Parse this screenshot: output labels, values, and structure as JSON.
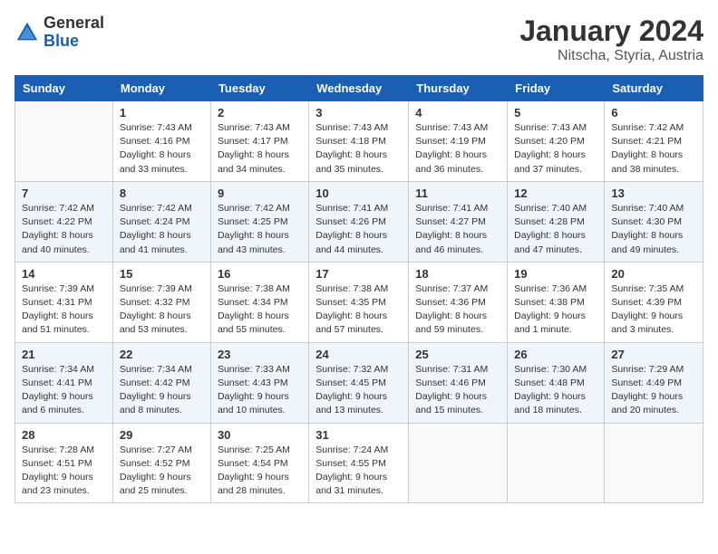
{
  "header": {
    "logo": {
      "general": "General",
      "blue": "Blue"
    },
    "title": "January 2024",
    "subtitle": "Nitscha, Styria, Austria"
  },
  "columns": [
    "Sunday",
    "Monday",
    "Tuesday",
    "Wednesday",
    "Thursday",
    "Friday",
    "Saturday"
  ],
  "weeks": [
    [
      {
        "day": "",
        "sunrise": "",
        "sunset": "",
        "daylight": ""
      },
      {
        "day": "1",
        "sunrise": "Sunrise: 7:43 AM",
        "sunset": "Sunset: 4:16 PM",
        "daylight": "Daylight: 8 hours and 33 minutes."
      },
      {
        "day": "2",
        "sunrise": "Sunrise: 7:43 AM",
        "sunset": "Sunset: 4:17 PM",
        "daylight": "Daylight: 8 hours and 34 minutes."
      },
      {
        "day": "3",
        "sunrise": "Sunrise: 7:43 AM",
        "sunset": "Sunset: 4:18 PM",
        "daylight": "Daylight: 8 hours and 35 minutes."
      },
      {
        "day": "4",
        "sunrise": "Sunrise: 7:43 AM",
        "sunset": "Sunset: 4:19 PM",
        "daylight": "Daylight: 8 hours and 36 minutes."
      },
      {
        "day": "5",
        "sunrise": "Sunrise: 7:43 AM",
        "sunset": "Sunset: 4:20 PM",
        "daylight": "Daylight: 8 hours and 37 minutes."
      },
      {
        "day": "6",
        "sunrise": "Sunrise: 7:42 AM",
        "sunset": "Sunset: 4:21 PM",
        "daylight": "Daylight: 8 hours and 38 minutes."
      }
    ],
    [
      {
        "day": "7",
        "sunrise": "Sunrise: 7:42 AM",
        "sunset": "Sunset: 4:22 PM",
        "daylight": "Daylight: 8 hours and 40 minutes."
      },
      {
        "day": "8",
        "sunrise": "Sunrise: 7:42 AM",
        "sunset": "Sunset: 4:24 PM",
        "daylight": "Daylight: 8 hours and 41 minutes."
      },
      {
        "day": "9",
        "sunrise": "Sunrise: 7:42 AM",
        "sunset": "Sunset: 4:25 PM",
        "daylight": "Daylight: 8 hours and 43 minutes."
      },
      {
        "day": "10",
        "sunrise": "Sunrise: 7:41 AM",
        "sunset": "Sunset: 4:26 PM",
        "daylight": "Daylight: 8 hours and 44 minutes."
      },
      {
        "day": "11",
        "sunrise": "Sunrise: 7:41 AM",
        "sunset": "Sunset: 4:27 PM",
        "daylight": "Daylight: 8 hours and 46 minutes."
      },
      {
        "day": "12",
        "sunrise": "Sunrise: 7:40 AM",
        "sunset": "Sunset: 4:28 PM",
        "daylight": "Daylight: 8 hours and 47 minutes."
      },
      {
        "day": "13",
        "sunrise": "Sunrise: 7:40 AM",
        "sunset": "Sunset: 4:30 PM",
        "daylight": "Daylight: 8 hours and 49 minutes."
      }
    ],
    [
      {
        "day": "14",
        "sunrise": "Sunrise: 7:39 AM",
        "sunset": "Sunset: 4:31 PM",
        "daylight": "Daylight: 8 hours and 51 minutes."
      },
      {
        "day": "15",
        "sunrise": "Sunrise: 7:39 AM",
        "sunset": "Sunset: 4:32 PM",
        "daylight": "Daylight: 8 hours and 53 minutes."
      },
      {
        "day": "16",
        "sunrise": "Sunrise: 7:38 AM",
        "sunset": "Sunset: 4:34 PM",
        "daylight": "Daylight: 8 hours and 55 minutes."
      },
      {
        "day": "17",
        "sunrise": "Sunrise: 7:38 AM",
        "sunset": "Sunset: 4:35 PM",
        "daylight": "Daylight: 8 hours and 57 minutes."
      },
      {
        "day": "18",
        "sunrise": "Sunrise: 7:37 AM",
        "sunset": "Sunset: 4:36 PM",
        "daylight": "Daylight: 8 hours and 59 minutes."
      },
      {
        "day": "19",
        "sunrise": "Sunrise: 7:36 AM",
        "sunset": "Sunset: 4:38 PM",
        "daylight": "Daylight: 9 hours and 1 minute."
      },
      {
        "day": "20",
        "sunrise": "Sunrise: 7:35 AM",
        "sunset": "Sunset: 4:39 PM",
        "daylight": "Daylight: 9 hours and 3 minutes."
      }
    ],
    [
      {
        "day": "21",
        "sunrise": "Sunrise: 7:34 AM",
        "sunset": "Sunset: 4:41 PM",
        "daylight": "Daylight: 9 hours and 6 minutes."
      },
      {
        "day": "22",
        "sunrise": "Sunrise: 7:34 AM",
        "sunset": "Sunset: 4:42 PM",
        "daylight": "Daylight: 9 hours and 8 minutes."
      },
      {
        "day": "23",
        "sunrise": "Sunrise: 7:33 AM",
        "sunset": "Sunset: 4:43 PM",
        "daylight": "Daylight: 9 hours and 10 minutes."
      },
      {
        "day": "24",
        "sunrise": "Sunrise: 7:32 AM",
        "sunset": "Sunset: 4:45 PM",
        "daylight": "Daylight: 9 hours and 13 minutes."
      },
      {
        "day": "25",
        "sunrise": "Sunrise: 7:31 AM",
        "sunset": "Sunset: 4:46 PM",
        "daylight": "Daylight: 9 hours and 15 minutes."
      },
      {
        "day": "26",
        "sunrise": "Sunrise: 7:30 AM",
        "sunset": "Sunset: 4:48 PM",
        "daylight": "Daylight: 9 hours and 18 minutes."
      },
      {
        "day": "27",
        "sunrise": "Sunrise: 7:29 AM",
        "sunset": "Sunset: 4:49 PM",
        "daylight": "Daylight: 9 hours and 20 minutes."
      }
    ],
    [
      {
        "day": "28",
        "sunrise": "Sunrise: 7:28 AM",
        "sunset": "Sunset: 4:51 PM",
        "daylight": "Daylight: 9 hours and 23 minutes."
      },
      {
        "day": "29",
        "sunrise": "Sunrise: 7:27 AM",
        "sunset": "Sunset: 4:52 PM",
        "daylight": "Daylight: 9 hours and 25 minutes."
      },
      {
        "day": "30",
        "sunrise": "Sunrise: 7:25 AM",
        "sunset": "Sunset: 4:54 PM",
        "daylight": "Daylight: 9 hours and 28 minutes."
      },
      {
        "day": "31",
        "sunrise": "Sunrise: 7:24 AM",
        "sunset": "Sunset: 4:55 PM",
        "daylight": "Daylight: 9 hours and 31 minutes."
      },
      {
        "day": "",
        "sunrise": "",
        "sunset": "",
        "daylight": ""
      },
      {
        "day": "",
        "sunrise": "",
        "sunset": "",
        "daylight": ""
      },
      {
        "day": "",
        "sunrise": "",
        "sunset": "",
        "daylight": ""
      }
    ]
  ]
}
